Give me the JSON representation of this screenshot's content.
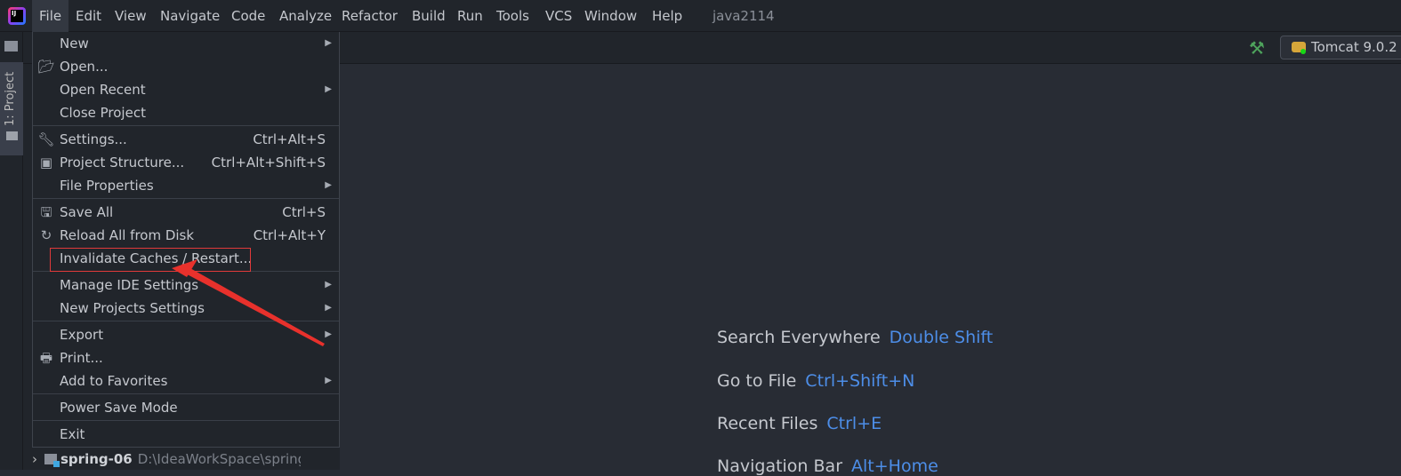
{
  "menubar": {
    "items": [
      "File",
      "Edit",
      "View",
      "Navigate",
      "Code",
      "Analyze",
      "Refactor",
      "Build",
      "Run",
      "Tools",
      "VCS",
      "Window",
      "Help"
    ],
    "project": "java2114",
    "logo": "IJ"
  },
  "toolbar": {
    "run_config": "Tomcat 9.0.2",
    "build_icon": "hammer-icon"
  },
  "left": {
    "project_tab": "1: Project"
  },
  "file_menu": {
    "items": [
      {
        "label": "New",
        "submenu": true
      },
      {
        "label": "Open...",
        "icon": "folder-open-icon"
      },
      {
        "label": "Open Recent",
        "submenu": true
      },
      {
        "label": "Close Project"
      },
      {
        "label": "Settings...",
        "shortcut": "Ctrl+Alt+S",
        "icon": "wrench-icon"
      },
      {
        "label": "Project Structure...",
        "shortcut": "Ctrl+Alt+Shift+S",
        "icon": "project-structure-icon"
      },
      {
        "label": "File Properties",
        "submenu": true
      },
      {
        "label": "Save All",
        "shortcut": "Ctrl+S",
        "icon": "save-icon"
      },
      {
        "label": "Reload All from Disk",
        "shortcut": "Ctrl+Alt+Y",
        "icon": "reload-icon"
      },
      {
        "label": "Invalidate Caches / Restart...",
        "highlighted": true
      },
      {
        "label": "Manage IDE Settings",
        "submenu": true
      },
      {
        "label": "New Projects Settings",
        "submenu": true
      },
      {
        "label": "Export",
        "submenu": true
      },
      {
        "label": "Print...",
        "icon": "print-icon"
      },
      {
        "label": "Add to Favorites",
        "submenu": true
      },
      {
        "label": "Power Save Mode"
      },
      {
        "label": "Exit"
      }
    ]
  },
  "tree": {
    "name": "spring-06",
    "path": "D:\\IdeaWorkSpace\\spring"
  },
  "welcome": [
    {
      "label": "Search Everywhere",
      "shortcut": "Double Shift"
    },
    {
      "label": "Go to File",
      "shortcut": "Ctrl+Shift+N"
    },
    {
      "label": "Recent Files",
      "shortcut": "Ctrl+E"
    },
    {
      "label": "Navigation Bar",
      "shortcut": "Alt+Home"
    }
  ],
  "colors": {
    "accent": "#4d8ee8",
    "annotation": "#e03a3a"
  }
}
